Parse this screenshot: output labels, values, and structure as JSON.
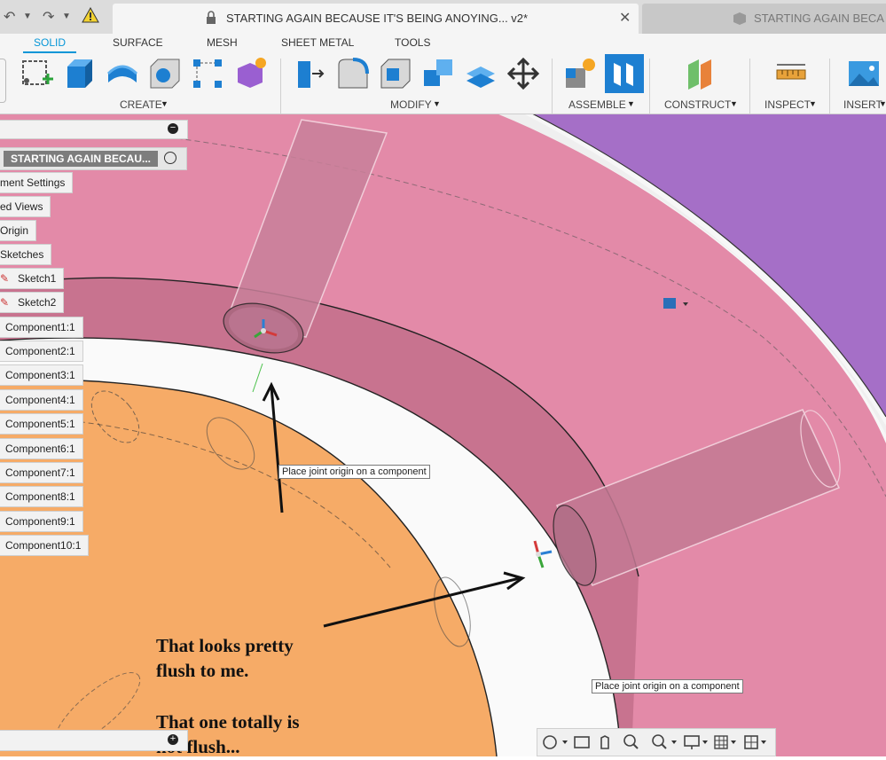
{
  "window": {
    "active_tab_title": "STARTING AGAIN BECAUSE IT'S BEING ANOYING... v2*",
    "inactive_tab_title": "STARTING AGAIN BECA"
  },
  "ribbon": {
    "tabs": [
      "SOLID",
      "SURFACE",
      "MESH",
      "SHEET METAL",
      "TOOLS"
    ],
    "groups": [
      "CREATE",
      "MODIFY",
      "ASSEMBLE",
      "CONSTRUCT",
      "INSPECT",
      "INSERT"
    ]
  },
  "browser": {
    "root": "STARTING AGAIN BECAU...",
    "items": [
      "ment Settings",
      "ed Views",
      "Origin",
      "Sketches",
      "Sketch1",
      "Sketch2",
      "Component1:1",
      "Component2:1",
      "Component3:1",
      "Component4:1",
      "Component5:1",
      "Component6:1",
      "Component7:1",
      "Component8:1",
      "Component9:1",
      "Component10:1"
    ]
  },
  "viewport": {
    "tooltip_1": "Place joint origin on a component",
    "tooltip_2": "Place joint origin on a component"
  },
  "annotations": {
    "text_1": "That looks pretty\nflush to me.",
    "text_2": "That one totally is\nnot flush..."
  },
  "colors": {
    "accent": "#0696d7",
    "pink_ring": "#e38aa8",
    "orange_disk": "#f6ab67",
    "purple_ring": "#a56fc7"
  }
}
